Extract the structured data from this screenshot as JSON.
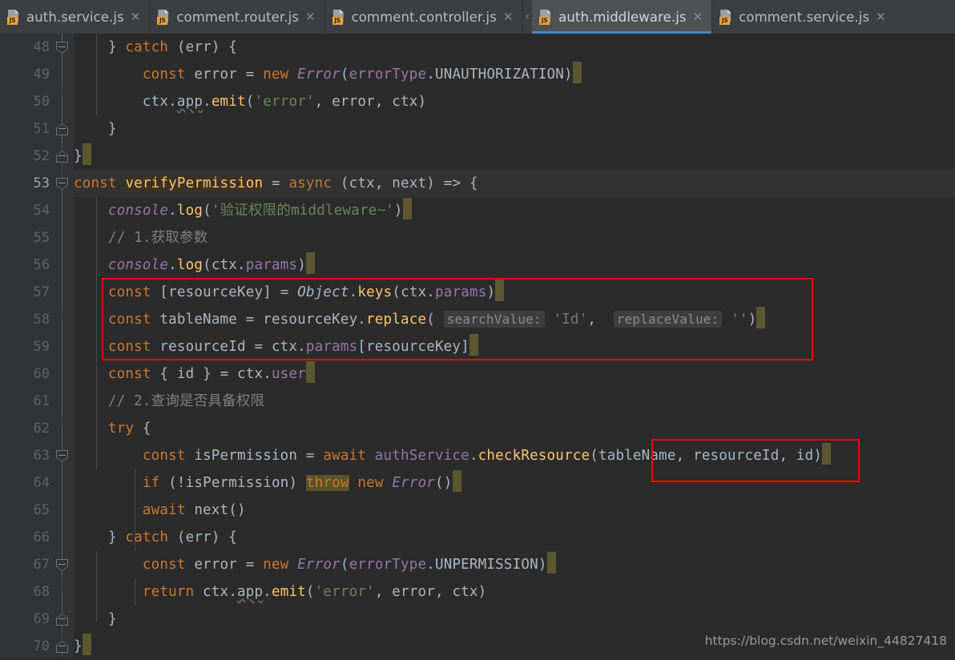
{
  "window": {
    "kind": "code-editor",
    "theme": "darcula",
    "background": "#2b2b2b",
    "accent": "#4a88c7",
    "annotation_color": "#ff0000"
  },
  "tabbar": {
    "close_glyph": "✕",
    "overflow_glyph": "‹",
    "icon_badge": "JS",
    "icon_name": "javascript-file-icon",
    "tabs": [
      {
        "label": "auth.service.js",
        "active": false
      },
      {
        "label": "comment.router.js",
        "active": false
      },
      {
        "label": "comment.controller.js",
        "active": false
      },
      {
        "label": "auth.middleware.js",
        "active": true
      },
      {
        "label": "comment.service.js",
        "active": false
      }
    ]
  },
  "editor": {
    "first_line": 48,
    "last_line": 70,
    "current_line": 53,
    "line_numbers": [
      48,
      49,
      50,
      51,
      52,
      53,
      54,
      55,
      56,
      57,
      58,
      59,
      60,
      61,
      62,
      63,
      64,
      65,
      66,
      67,
      68,
      69,
      70
    ],
    "lines": [
      {
        "n": 48,
        "text": "    } catch (err) {"
      },
      {
        "n": 49,
        "text": "        const error = new Error(errorType.UNAUTHORIZATION)"
      },
      {
        "n": 50,
        "text": "        ctx.app.emit('error', error, ctx)"
      },
      {
        "n": 51,
        "text": "    }"
      },
      {
        "n": 52,
        "text": "}"
      },
      {
        "n": 53,
        "text": "const verifyPermission = async (ctx, next) => {"
      },
      {
        "n": 54,
        "text": "    console.log('验证权限的middleware~')"
      },
      {
        "n": 55,
        "text": "    // 1.获取参数"
      },
      {
        "n": 56,
        "text": "    console.log(ctx.params)"
      },
      {
        "n": 57,
        "text": "    const [resourceKey] = Object.keys(ctx.params)"
      },
      {
        "n": 58,
        "text": "    const tableName = resourceKey.replace( searchValue: 'Id',  replaceValue: '')"
      },
      {
        "n": 59,
        "text": "    const resourceId = ctx.params[resourceKey]"
      },
      {
        "n": 60,
        "text": "    const { id } = ctx.user"
      },
      {
        "n": 61,
        "text": "    // 2.查询是否具备权限"
      },
      {
        "n": 62,
        "text": "    try {"
      },
      {
        "n": 63,
        "text": "        const isPermission = await authService.checkResource(tableName, resourceId, id)"
      },
      {
        "n": 64,
        "text": "        if (!isPermission) throw new Error()"
      },
      {
        "n": 65,
        "text": "        await next()"
      },
      {
        "n": 66,
        "text": "    } catch (err) {"
      },
      {
        "n": 67,
        "text": "        const error = new Error(errorType.UNPERMISSION)"
      },
      {
        "n": 68,
        "text": "        return ctx.app.emit('error', error, ctx)"
      },
      {
        "n": 69,
        "text": "    }"
      },
      {
        "n": 70,
        "text": "}"
      }
    ],
    "inline_hints": [
      {
        "line": 58,
        "label": "searchValue:"
      },
      {
        "line": 58,
        "label": "replaceValue:"
      }
    ],
    "highlighted_identifier": "verifyPermission",
    "highlighted_keyword": "throw",
    "fold_markers": [
      {
        "line": 48,
        "state": "open"
      },
      {
        "line": 51,
        "state": "close"
      },
      {
        "line": 52,
        "state": "close"
      },
      {
        "line": 53,
        "state": "open"
      },
      {
        "line": 62,
        "state": "open"
      },
      {
        "line": 66,
        "state": "open"
      },
      {
        "line": 69,
        "state": "close"
      },
      {
        "line": 70,
        "state": "close"
      }
    ],
    "annotations": [
      {
        "name": "red-box-params",
        "lines": "57-59"
      },
      {
        "name": "red-box-args",
        "lines": "63"
      }
    ]
  },
  "watermark": {
    "text": "https://blog.csdn.net/weixin_44827418"
  }
}
